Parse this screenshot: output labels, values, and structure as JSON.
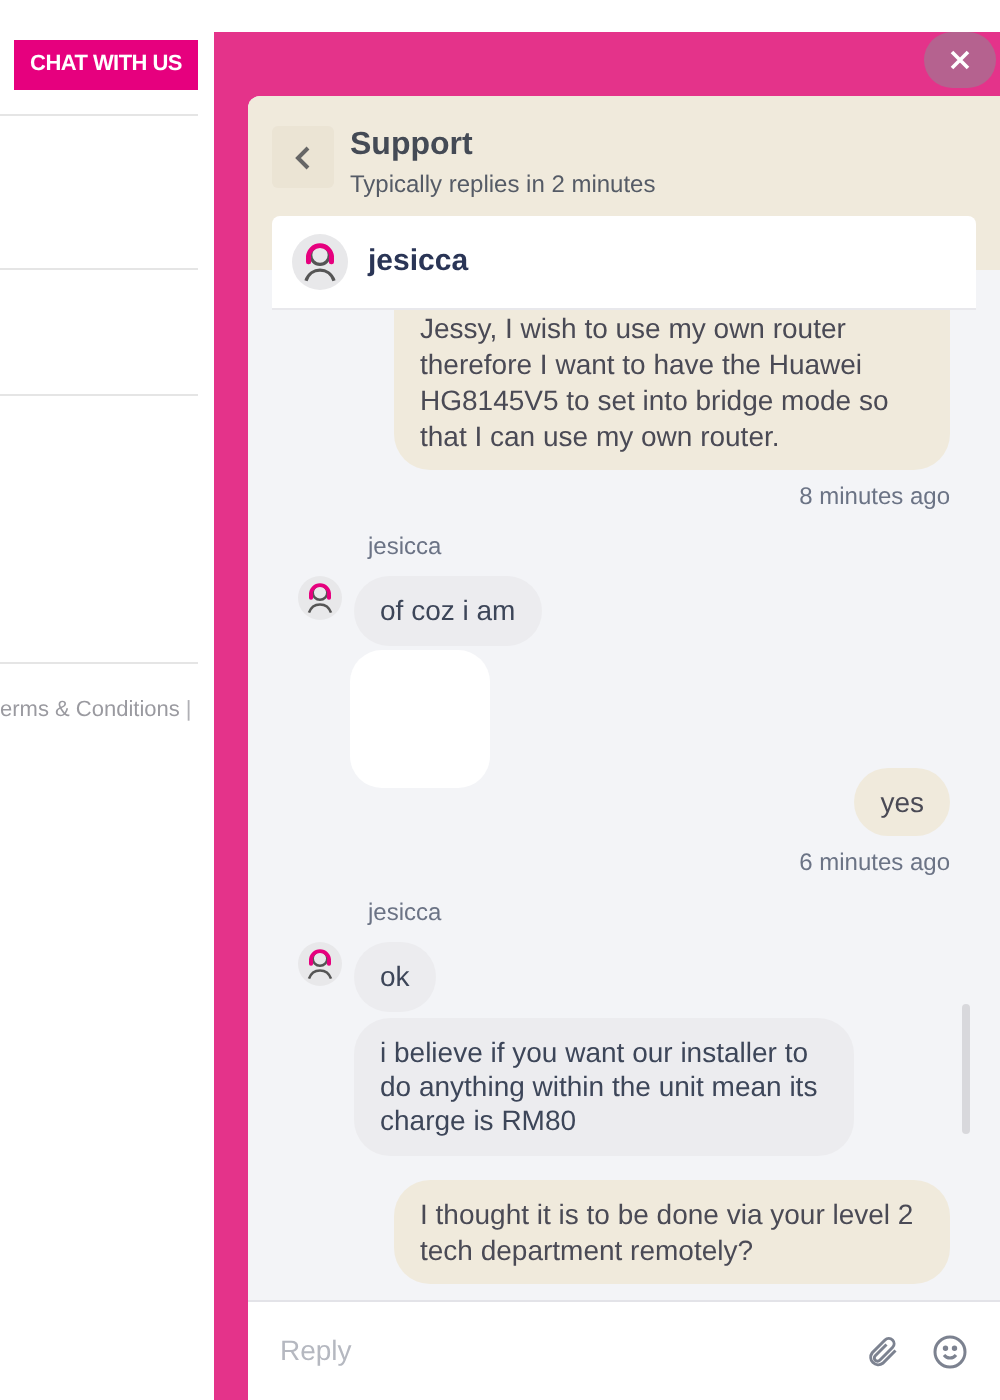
{
  "page": {
    "chat_button": "CHAT WITH US",
    "footer_link": "erms & Conditions",
    "footer_separator": "|"
  },
  "widget": {
    "title": "Support",
    "subtitle": "Typically replies in 2 minutes",
    "agent_name": "jesicca",
    "messages": [
      {
        "kind": "user",
        "text": "Jessy, I wish to use my own router therefore I want to have the Huawei HG8145V5 to set into bridge mode so that I can use my own router."
      },
      {
        "kind": "time",
        "text": "8 minutes ago"
      },
      {
        "kind": "sender",
        "text": "jesicca"
      },
      {
        "kind": "agent",
        "text": "of coz i am",
        "avatar": true
      },
      {
        "kind": "image"
      },
      {
        "kind": "user",
        "text": "yes"
      },
      {
        "kind": "time",
        "text": "6 minutes ago"
      },
      {
        "kind": "sender",
        "text": "jesicca"
      },
      {
        "kind": "agent",
        "text": "ok",
        "avatar": true
      },
      {
        "kind": "agent",
        "text": "i believe if you want our installer to do anything within the unit mean its charge is RM80",
        "avatar": false
      },
      {
        "kind": "user",
        "text": "I thought it is to be done via your level 2 tech department remotely?"
      }
    ],
    "reply_placeholder": "Reply"
  }
}
